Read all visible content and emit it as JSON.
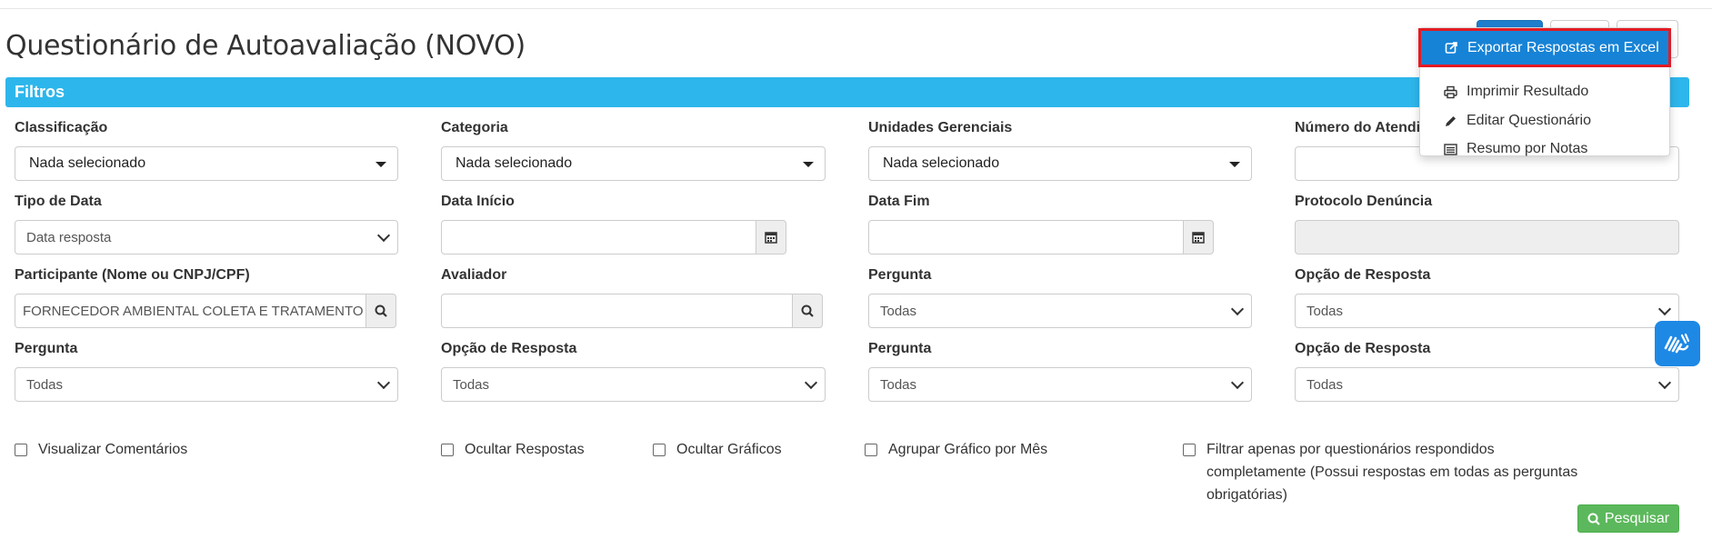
{
  "page": {
    "title": "Questionário de Autoavaliação (NOVO)"
  },
  "menu": {
    "items": [
      {
        "label": "Exportar Respostas em Excel",
        "icon": "export-icon"
      },
      {
        "label": "Imprimir Resultado",
        "icon": "print-icon"
      },
      {
        "label": "Editar Questionário",
        "icon": "pencil-icon"
      },
      {
        "label": "Resumo por Notas",
        "icon": "list-icon"
      }
    ]
  },
  "filters": {
    "header": "Filtros",
    "classificacao": {
      "label": "Classificação",
      "value": "Nada selecionado"
    },
    "categoria": {
      "label": "Categoria",
      "value": "Nada selecionado"
    },
    "unidades": {
      "label": "Unidades Gerenciais",
      "value": "Nada selecionado"
    },
    "numero_atendimento": {
      "label": "Número do Atendim",
      "value": ""
    },
    "tipo_data": {
      "label": "Tipo de Data",
      "value": "Data resposta"
    },
    "data_inicio": {
      "label": "Data Início",
      "value": ""
    },
    "data_fim": {
      "label": "Data Fim",
      "value": ""
    },
    "protocolo": {
      "label": "Protocolo Denúncia",
      "value": ""
    },
    "participante": {
      "label": "Participante (Nome ou CNPJ/CPF)",
      "value": "FORNECEDOR AMBIENTAL COLETA E TRATAMENTO"
    },
    "avaliador": {
      "label": "Avaliador",
      "value": ""
    },
    "pergunta_1": {
      "label": "Pergunta",
      "value": "Todas"
    },
    "opcao_1": {
      "label": "Opção de Resposta",
      "value": "Todas"
    },
    "pergunta_2": {
      "label": "Pergunta",
      "value": "Todas"
    },
    "opcao_2": {
      "label": "Opção de Resposta",
      "value": "Todas"
    },
    "pergunta_3": {
      "label": "Pergunta",
      "value": "Todas"
    },
    "opcao_3": {
      "label": "Opção de Resposta",
      "value": "Todas"
    }
  },
  "checkboxes": {
    "comentarios": "Visualizar Comentários",
    "ocultar_respostas": "Ocultar Respostas",
    "ocultar_graficos": "Ocultar Gráficos",
    "agrupar": "Agrupar Gráfico por Mês",
    "filtrar": "Filtrar apenas por questionários respondidos completamente (Possui respostas em todas as perguntas obrigatórias)"
  },
  "actions": {
    "pesquisar": "Pesquisar"
  },
  "colors": {
    "accent": "#2db6ec",
    "menu_active": "#1783d6",
    "highlight": "#e21b23",
    "success": "#5cb85c"
  }
}
